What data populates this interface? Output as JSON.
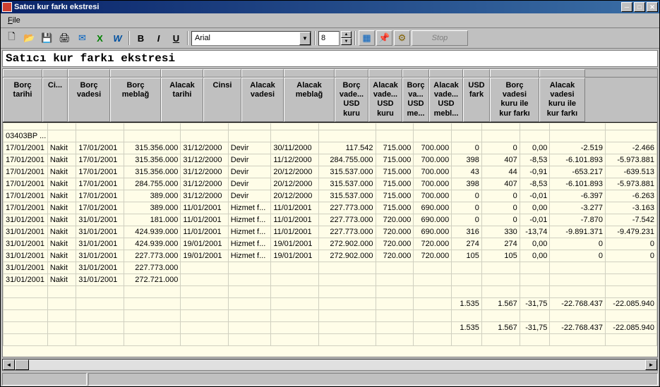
{
  "window": {
    "title": "Satıcı kur farkı ekstresi"
  },
  "menu": {
    "file": "File"
  },
  "toolbar": {
    "font": "Arial",
    "size": "8",
    "stop": "Stop"
  },
  "report_title": "Satıcı kur farkı ekstresi",
  "columns": [
    "Borç\ntarihi",
    "Ci...",
    "Borç\nvadesi",
    "Borç\nmeblağ",
    "Alacak\ntarihi",
    "Cinsi",
    "Alacak\nvadesi",
    "Alacak\nmeblağ",
    "Borç\nvade...\nUSD\nkuru",
    "Alacak\nvade...\nUSD\nkuru",
    "Borç\nva...\nUSD\nme...",
    "Alacak\nvade...\nUSD\nmebl...",
    "USD\nfark",
    "Borç\nvadesi\nkuru ile\nkur farkı",
    "Alacak\nvadesi\nkuru ile\nkur farkı"
  ],
  "group_label": "03403BP ...",
  "rows": [
    [
      "17/01/2001",
      "Nakit",
      "17/01/2001",
      "315.356.000",
      "31/12/2000",
      "Devir",
      "30/11/2000",
      "117.542",
      "715.000",
      "700.000",
      "0",
      "0",
      "0,00",
      "-2.519",
      "-2.466"
    ],
    [
      "17/01/2001",
      "Nakit",
      "17/01/2001",
      "315.356.000",
      "31/12/2000",
      "Devir",
      "11/12/2000",
      "284.755.000",
      "715.000",
      "700.000",
      "398",
      "407",
      "-8,53",
      "-6.101.893",
      "-5.973.881"
    ],
    [
      "17/01/2001",
      "Nakit",
      "17/01/2001",
      "315.356.000",
      "31/12/2000",
      "Devir",
      "20/12/2000",
      "315.537.000",
      "715.000",
      "700.000",
      "43",
      "44",
      "-0,91",
      "-653.217",
      "-639.513"
    ],
    [
      "17/01/2001",
      "Nakit",
      "17/01/2001",
      "284.755.000",
      "31/12/2000",
      "Devir",
      "20/12/2000",
      "315.537.000",
      "715.000",
      "700.000",
      "398",
      "407",
      "-8,53",
      "-6.101.893",
      "-5.973.881"
    ],
    [
      "17/01/2001",
      "Nakit",
      "17/01/2001",
      "389.000",
      "31/12/2000",
      "Devir",
      "20/12/2000",
      "315.537.000",
      "715.000",
      "700.000",
      "0",
      "0",
      "-0,01",
      "-6.397",
      "-6.263"
    ],
    [
      "17/01/2001",
      "Nakit",
      "17/01/2001",
      "389.000",
      "11/01/2001",
      "Hizmet f...",
      "11/01/2001",
      "227.773.000",
      "715.000",
      "690.000",
      "0",
      "0",
      "0,00",
      "-3.277",
      "-3.163"
    ],
    [
      "31/01/2001",
      "Nakit",
      "31/01/2001",
      "181.000",
      "11/01/2001",
      "Hizmet f...",
      "11/01/2001",
      "227.773.000",
      "720.000",
      "690.000",
      "0",
      "0",
      "-0,01",
      "-7.870",
      "-7.542"
    ],
    [
      "31/01/2001",
      "Nakit",
      "31/01/2001",
      "424.939.000",
      "11/01/2001",
      "Hizmet f...",
      "11/01/2001",
      "227.773.000",
      "720.000",
      "690.000",
      "316",
      "330",
      "-13,74",
      "-9.891.371",
      "-9.479.231"
    ],
    [
      "31/01/2001",
      "Nakit",
      "31/01/2001",
      "424.939.000",
      "19/01/2001",
      "Hizmet f...",
      "19/01/2001",
      "272.902.000",
      "720.000",
      "720.000",
      "274",
      "274",
      "0,00",
      "0",
      "0"
    ],
    [
      "31/01/2001",
      "Nakit",
      "31/01/2001",
      "227.773.000",
      "19/01/2001",
      "Hizmet f...",
      "19/01/2001",
      "272.902.000",
      "720.000",
      "720.000",
      "105",
      "105",
      "0,00",
      "0",
      "0"
    ],
    [
      "31/01/2001",
      "Nakit",
      "31/01/2001",
      "227.773.000",
      "",
      "",
      "",
      "",
      "",
      "",
      "",
      "",
      "",
      "",
      ""
    ],
    [
      "31/01/2001",
      "Nakit",
      "31/01/2001",
      "272.721.000",
      "",
      "",
      "",
      "",
      "",
      "",
      "",
      "",
      "",
      "",
      ""
    ]
  ],
  "totals": [
    "",
    "",
    "",
    "",
    "",
    "",
    "",
    "",
    "",
    "",
    "1.535",
    "1.567",
    "-31,75",
    "-22.768.437",
    "-22.085.940"
  ],
  "grand": [
    "",
    "",
    "",
    "",
    "",
    "",
    "",
    "",
    "",
    "",
    "1.535",
    "1.567",
    "-31,75",
    "-22.768.437",
    "-22.085.940"
  ]
}
